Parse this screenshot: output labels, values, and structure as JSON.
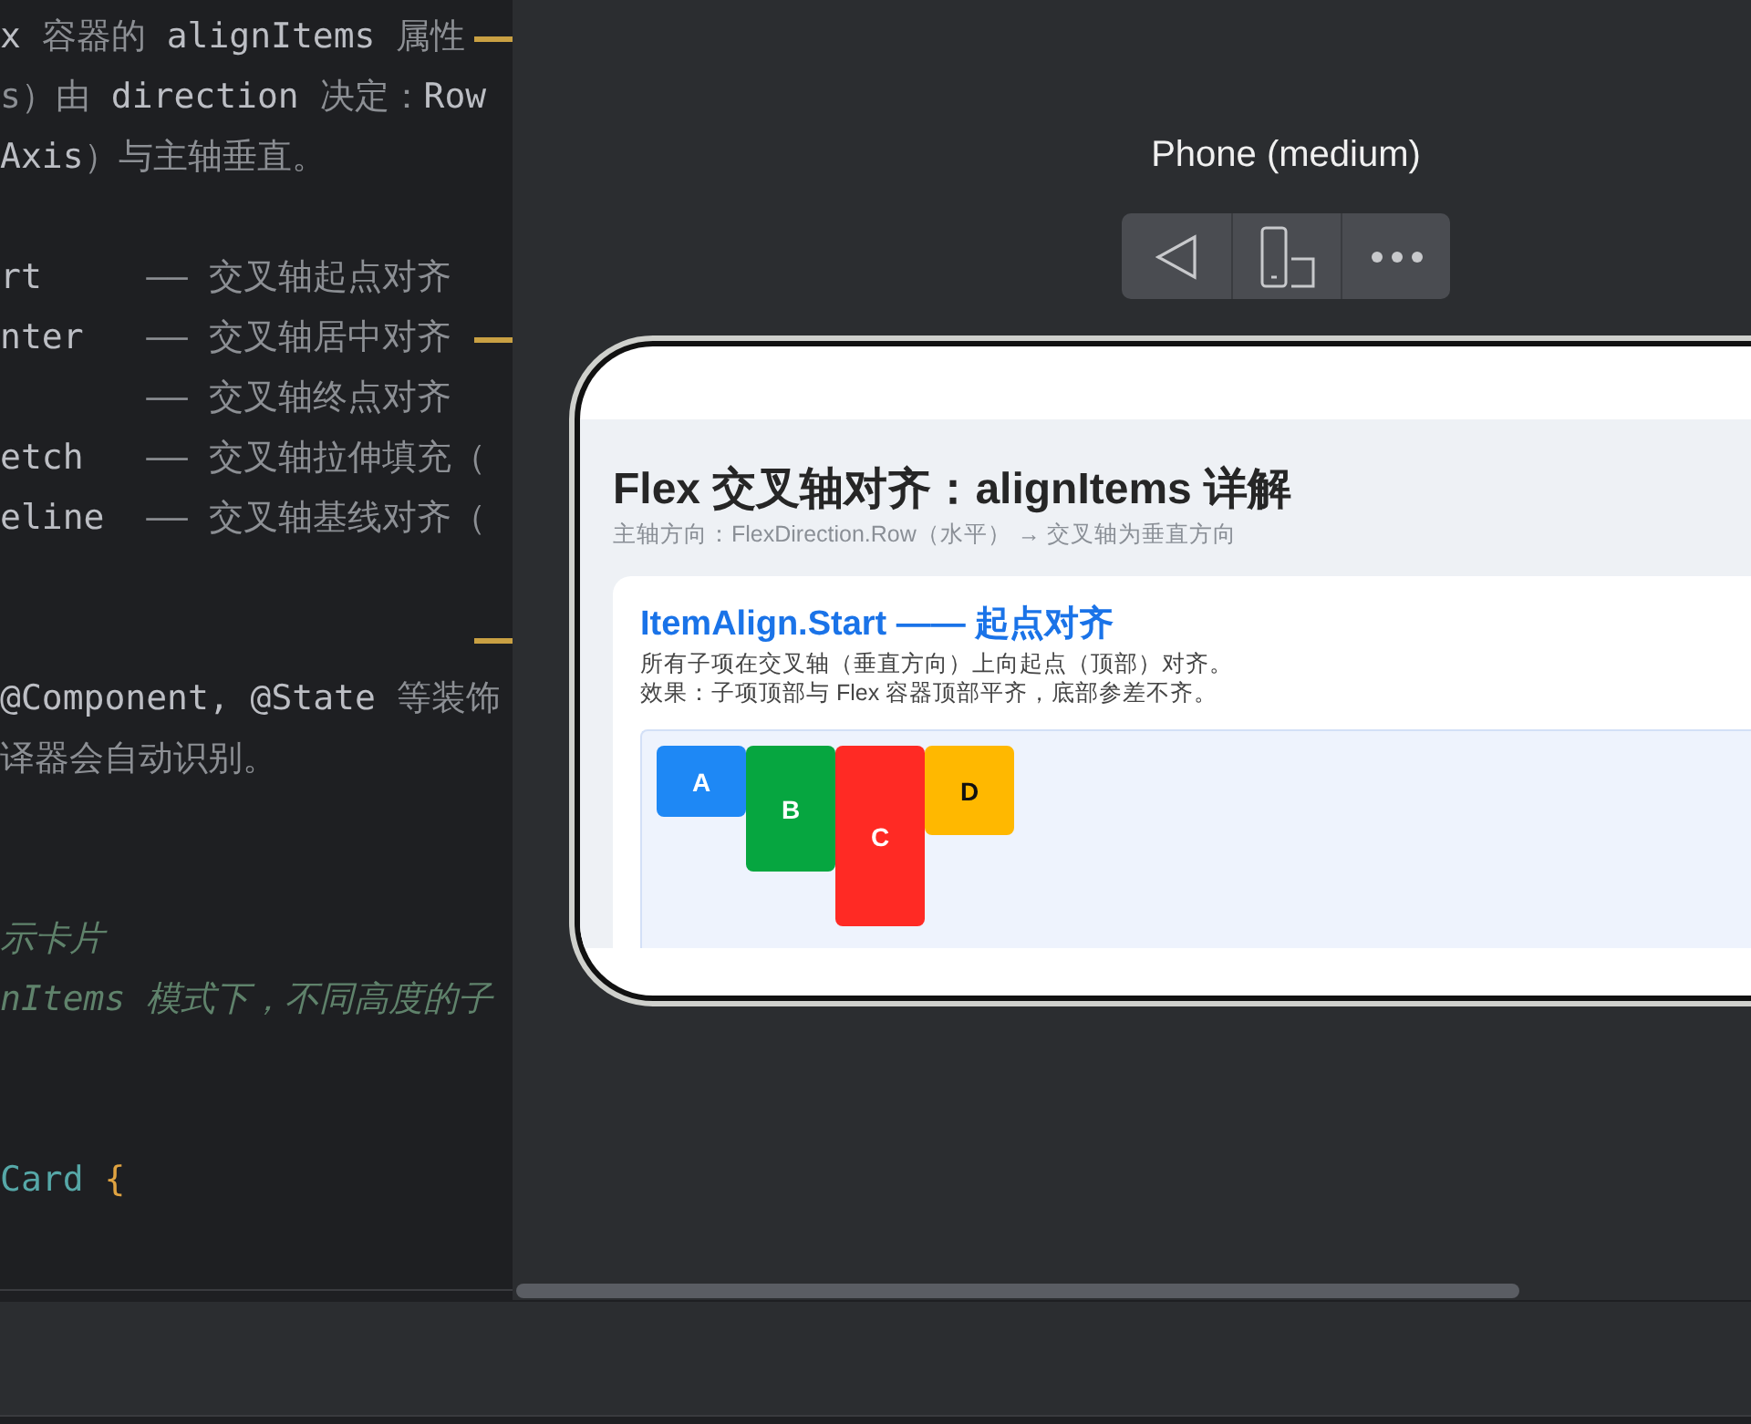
{
  "editor": {
    "lines": [
      {
        "changed": true,
        "segments": [
          {
            "text": "x ",
            "kind": "code"
          },
          {
            "text": "容器的 ",
            "kind": "doc"
          },
          {
            "text": "alignItems ",
            "kind": "code"
          },
          {
            "text": "属性",
            "kind": "doc"
          }
        ]
      },
      {
        "changed": false,
        "segments": [
          {
            "text": "s）由 ",
            "kind": "doc"
          },
          {
            "text": "direction ",
            "kind": "code"
          },
          {
            "text": "决定：",
            "kind": "doc"
          },
          {
            "text": "Row",
            "kind": "code"
          }
        ]
      },
      {
        "changed": false,
        "segments": [
          {
            "text": "Axis",
            "kind": "code"
          },
          {
            "text": "）与主轴垂直。",
            "kind": "doc"
          }
        ]
      },
      {
        "changed": false
      },
      {
        "changed": false,
        "segments": [
          {
            "text": "rt     ",
            "kind": "code"
          },
          {
            "text": "—— 交叉轴起点对齐",
            "kind": "doc"
          }
        ]
      },
      {
        "changed": true,
        "segments": [
          {
            "text": "nter   ",
            "kind": "code"
          },
          {
            "text": "—— 交叉轴居中对齐",
            "kind": "doc"
          }
        ]
      },
      {
        "changed": false,
        "segments": [
          {
            "text": "       —— 交叉轴终点对齐",
            "kind": "doc"
          }
        ]
      },
      {
        "changed": false,
        "segments": [
          {
            "text": "etch   ",
            "kind": "code"
          },
          {
            "text": "—— 交叉轴拉伸填充（",
            "kind": "doc"
          }
        ]
      },
      {
        "changed": false,
        "segments": [
          {
            "text": "eline  ",
            "kind": "code"
          },
          {
            "text": "—— 交叉轴基线对齐（",
            "kind": "doc"
          }
        ]
      },
      {
        "changed": false
      },
      {
        "changed": true
      },
      {
        "changed": false,
        "segments": [
          {
            "text": "@Component, @State ",
            "kind": "code"
          },
          {
            "text": "等装饰",
            "kind": "doc"
          }
        ]
      },
      {
        "changed": false,
        "segments": [
          {
            "text": "译器会自动识别。",
            "kind": "doc"
          }
        ]
      },
      {
        "changed": false
      },
      {
        "changed": false
      },
      {
        "changed": false,
        "segments": [
          {
            "text": "示卡片",
            "kind": "comment"
          }
        ]
      },
      {
        "changed": false,
        "segments": [
          {
            "text": "nItems ",
            "kind": "comment"
          },
          {
            "text": "模式下，不同高度的子",
            "kind": "comment"
          }
        ]
      },
      {
        "changed": false
      },
      {
        "changed": false
      },
      {
        "changed": false,
        "segments": [
          {
            "text": "Card ",
            "kind": "type"
          },
          {
            "text": "{",
            "kind": "brace"
          }
        ]
      }
    ]
  },
  "preview": {
    "device_label": "Phone (medium)",
    "toolbar": [
      {
        "kind": "back"
      },
      {
        "kind": "rotate"
      },
      {
        "kind": "more"
      }
    ],
    "page": {
      "title": "Flex 交叉轴对齐：alignItems 详解",
      "subtitle": "主轴方向：FlexDirection.Row（水平） → 交叉轴为垂直方向",
      "card": {
        "title": "ItemAlign.Start —— 起点对齐",
        "description": [
          "所有子项在交叉轴（垂直方向）上向起点（顶部）对齐。",
          "效果：子项顶部与 Flex 容器顶部平齐，底部参差不齐。"
        ],
        "items": [
          {
            "label": "A",
            "color": "#1e88f5"
          },
          {
            "label": "B",
            "color": "#06a640"
          },
          {
            "label": "C",
            "color": "#ff2a24"
          },
          {
            "label": "D",
            "color": "#ffb800"
          }
        ]
      }
    }
  }
}
